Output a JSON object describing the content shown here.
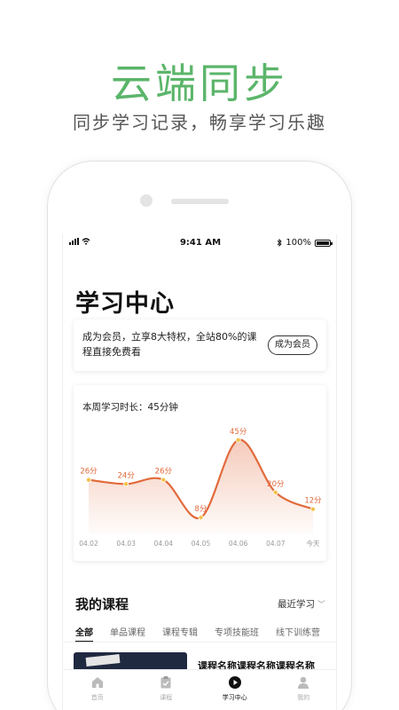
{
  "promo": {
    "title": "云端同步",
    "subtitle": "同步学习记录，畅享学习乐趣"
  },
  "status_bar": {
    "time": "9:41 AM",
    "battery": "100%"
  },
  "page": {
    "title": "学习中心"
  },
  "member": {
    "text": "成为会员，立享8大特权，全站80%的课程直接免费看",
    "button": "成为会员"
  },
  "weekly": {
    "label": "本周学习时长：45分钟"
  },
  "chart_data": {
    "type": "line",
    "title": "",
    "x": [
      "04.02",
      "04.03",
      "04.04",
      "04.05",
      "04.06",
      "04.07",
      "今天"
    ],
    "series": [
      {
        "values": [
          26,
          24,
          26,
          8,
          45,
          20,
          12
        ]
      }
    ],
    "point_labels": [
      "26分",
      "24分",
      "26分",
      "8分",
      "45分",
      "20分",
      "12分"
    ],
    "ylim": [
      0,
      50
    ],
    "grid": false,
    "colors": {
      "line": "#e26a3c",
      "point": "#f3c14a",
      "label": "#e26a3c"
    }
  },
  "courses": {
    "title": "我的课程",
    "sort_label": "最近学习",
    "tabs": [
      "全部",
      "单品课程",
      "课程专辑",
      "专项技能班",
      "线下训练营"
    ],
    "items": [
      {
        "name": "课程名称课程名称课程名称"
      }
    ]
  },
  "tabbar": [
    {
      "label": "首页",
      "icon": "home-icon"
    },
    {
      "label": "课程",
      "icon": "clipboard-icon"
    },
    {
      "label": "学习中心",
      "icon": "play-circle-icon"
    },
    {
      "label": "我的",
      "icon": "user-icon"
    }
  ],
  "colors": {
    "brand_green": "#5bb56a",
    "accent_orange": "#e26a3c"
  }
}
